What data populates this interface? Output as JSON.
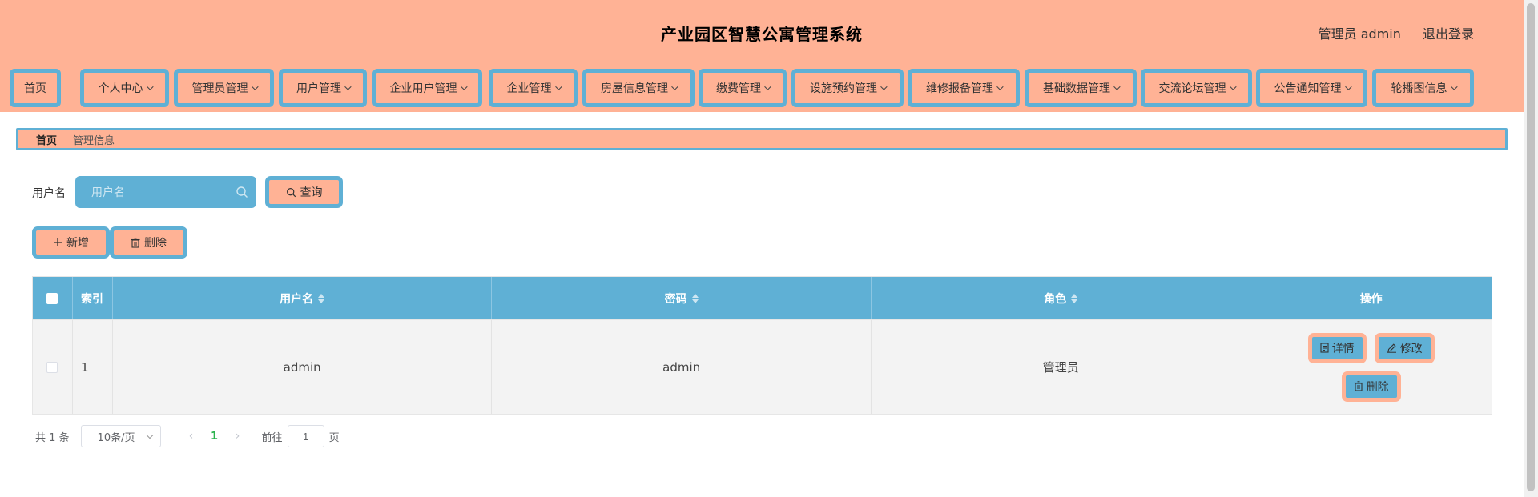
{
  "header": {
    "title": "产业园区智慧公寓管理系统",
    "user_label": "管理员 admin",
    "logout_label": "退出登录"
  },
  "nav": {
    "items": [
      {
        "label": "首页",
        "has_dropdown": false
      },
      {
        "label": "个人中心",
        "has_dropdown": true
      },
      {
        "label": "管理员管理",
        "has_dropdown": true
      },
      {
        "label": "用户管理",
        "has_dropdown": true
      },
      {
        "label": "企业用户管理",
        "has_dropdown": true
      },
      {
        "label": "企业管理",
        "has_dropdown": true
      },
      {
        "label": "房屋信息管理",
        "has_dropdown": true
      },
      {
        "label": "缴费管理",
        "has_dropdown": true
      },
      {
        "label": "设施预约管理",
        "has_dropdown": true
      },
      {
        "label": "维修报备管理",
        "has_dropdown": true
      },
      {
        "label": "基础数据管理",
        "has_dropdown": true
      },
      {
        "label": "交流论坛管理",
        "has_dropdown": true
      },
      {
        "label": "公告通知管理",
        "has_dropdown": true
      },
      {
        "label": "轮播图信息",
        "has_dropdown": true
      }
    ]
  },
  "breadcrumb": {
    "home": "首页",
    "current": "管理信息"
  },
  "search": {
    "label": "用户名",
    "placeholder": "用户名",
    "value": "",
    "query_button": "查询"
  },
  "actions": {
    "add_label": "新增",
    "delete_label": "删除"
  },
  "table": {
    "headers": {
      "index": "索引",
      "username": "用户名",
      "password": "密码",
      "role": "角色",
      "operation": "操作"
    },
    "rows": [
      {
        "index": "1",
        "username": "admin",
        "password": "admin",
        "role": "管理员"
      }
    ],
    "row_actions": {
      "detail": "详情",
      "edit": "修改",
      "delete": "删除"
    }
  },
  "pagination": {
    "total_text": "共 1 条",
    "page_size": "10条/页",
    "current_page": "1",
    "goto_label": "前往",
    "goto_value": "1",
    "page_suffix": "页"
  },
  "colors": {
    "salmon": "#ffb295",
    "blue": "#5fb0d5",
    "active_page": "#2ab34d"
  }
}
